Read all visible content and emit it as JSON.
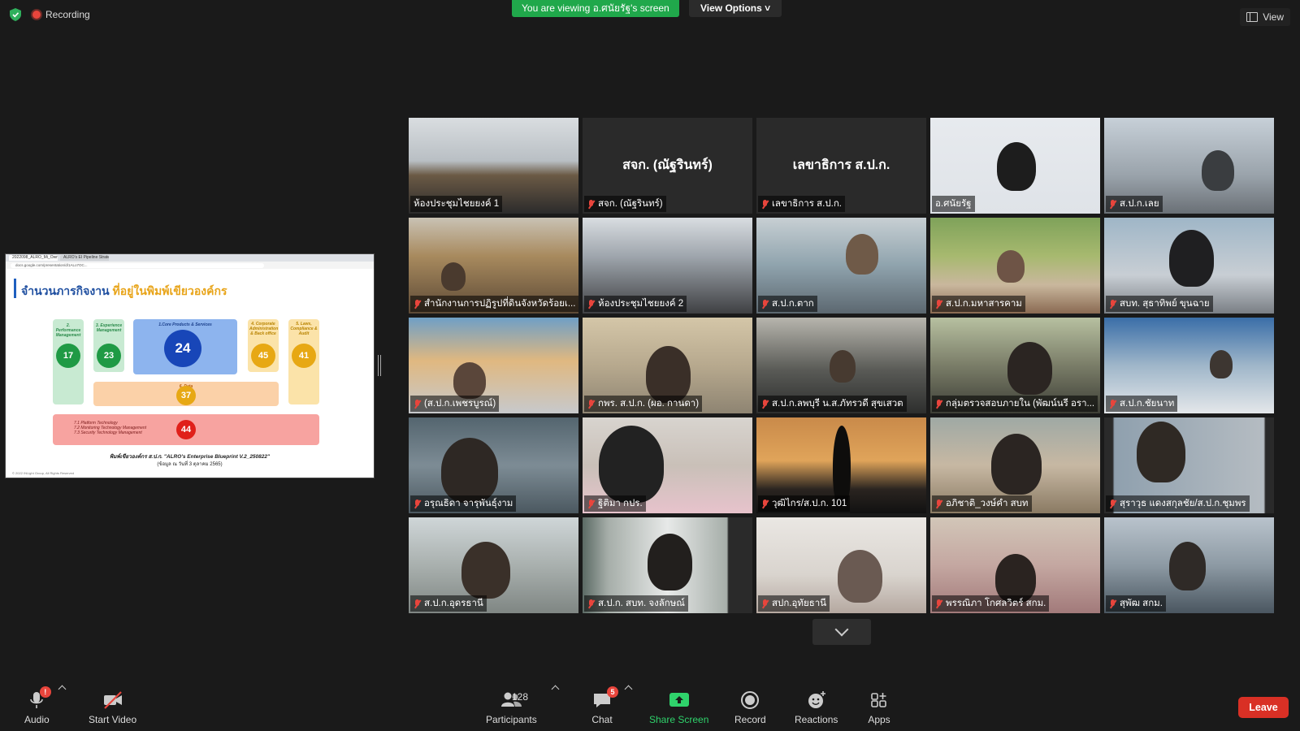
{
  "top": {
    "recording_label": "Recording",
    "viewing_banner": "You are viewing อ.ศนัยรัฐ's screen",
    "view_options_label": "View Options",
    "view_label": "View"
  },
  "shared_screen": {
    "browser_tabs": [
      "2022098_ALRO_Mi_Owner",
      "ALRO's EI Pipeline Strategy"
    ],
    "url": "docs.google.com/presentation/d/1ALo7OC...",
    "slide": {
      "title_part1": "จำนวนภารกิจงาน",
      "title_part2": "ที่อยู่ในพิมพ์เขียวองค์กร",
      "columns": [
        {
          "label": "2. Performance Management",
          "value": "17"
        },
        {
          "label": "3. Experience Management",
          "value": "23"
        },
        {
          "label": "1.Core Products & Services",
          "value": "24"
        },
        {
          "label": "4. Corporate Administration & Back office",
          "value": "45"
        },
        {
          "label": "5. Laws, Compliance & Audit",
          "value": "41"
        }
      ],
      "data_label": "6. Data",
      "data_value": "37",
      "tech_lines": [
        "7.1 Platform Technology",
        "7.2 Monitoring Technology Management",
        "7.3 Security Technology Management"
      ],
      "tech_value": "44",
      "caption": "พิมพ์เขียวองค์กร ส.ป.ก. \"ALRO's Enterprise Blueprint V.2_250822\"",
      "caption_sub": "(ข้อมูล ณ วันที่ 3 ตุลาคม 2565)",
      "footer": "© 2022 INLight Group, All Rights Reserved"
    }
  },
  "participants": [
    {
      "name": "ห้องประชุมไชยยงค์ 1",
      "muted": false,
      "video": true
    },
    {
      "name": "สจก. (ณัฐรินทร์)",
      "muted": true,
      "video": false
    },
    {
      "name": "เลขาธิการ ส.ป.ก.",
      "muted": true,
      "video": false
    },
    {
      "name": "อ.ศนัยรัฐ",
      "muted": false,
      "video": true,
      "active": true
    },
    {
      "name": "ส.ป.ก.เลย",
      "muted": true,
      "video": true
    },
    {
      "name": "สำนักงานการปฏิรูปที่ดินจังหวัดร้อยเ...",
      "muted": true,
      "video": true
    },
    {
      "name": "ห้องประชุมไชยยงค์ 2",
      "muted": true,
      "video": true
    },
    {
      "name": "ส.ป.ก.ตาก",
      "muted": true,
      "video": true
    },
    {
      "name": "ส.ป.ก.มหาสารคาม",
      "muted": true,
      "video": true
    },
    {
      "name": "สบท. สุธาทิพย์ ขุนฉาย",
      "muted": true,
      "video": true
    },
    {
      "name": "(ส.ป.ก.เพชรบูรณ์)",
      "muted": true,
      "video": true
    },
    {
      "name": "กพร. ส.ป.ก. (ผอ. กานดา)",
      "muted": true,
      "video": true
    },
    {
      "name": "ส.ป.ก.ลพบุรี น.ส.ภัทรวดี สุขเสวต",
      "muted": true,
      "video": true
    },
    {
      "name": "กลุ่มตรวจสอบภายใน (พัฒน์นรี อรา...",
      "muted": true,
      "video": true
    },
    {
      "name": "ส.ป.ก.ชัยนาท",
      "muted": true,
      "video": true
    },
    {
      "name": "อรุณธิดา จารุพันธุ์งาม",
      "muted": true,
      "video": true
    },
    {
      "name": "ฐิติมา กปร.",
      "muted": true,
      "video": true
    },
    {
      "name": "วุฒิไกร/ส.ป.ก. 101",
      "muted": true,
      "video": true
    },
    {
      "name": "อภิชาติ_วงษ์คำ สบท",
      "muted": true,
      "video": true
    },
    {
      "name": "สุราวุธ แดงสกุลชัย/ส.ป.ก.ชุมพร",
      "muted": true,
      "video": true
    },
    {
      "name": "ส.ป.ก.อุดรธานี",
      "muted": true,
      "video": true
    },
    {
      "name": "ส.ป.ก. สบท. จงลักษณ์",
      "muted": true,
      "video": true
    },
    {
      "name": "สปก.อุทัยธานี",
      "muted": true,
      "video": true
    },
    {
      "name": "พรรณิภา โกศลวิตร์ สกม.",
      "muted": true,
      "video": true
    },
    {
      "name": "สุพัฒ สกม.",
      "muted": true,
      "video": true
    }
  ],
  "toolbar": {
    "audio_label": "Audio",
    "audio_badge": "!",
    "video_label": "Start Video",
    "participants_label": "Participants",
    "participants_count": "128",
    "chat_label": "Chat",
    "chat_badge": "5",
    "share_label": "Share Screen",
    "record_label": "Record",
    "reactions_label": "Reactions",
    "apps_label": "Apps",
    "leave_label": "Leave"
  },
  "colors": {
    "share_green": "#2fd26b",
    "banner_green": "#20a84b",
    "leave_red": "#d93025",
    "active_speaker": "#c4e24a",
    "muted_red": "#e8453c"
  }
}
